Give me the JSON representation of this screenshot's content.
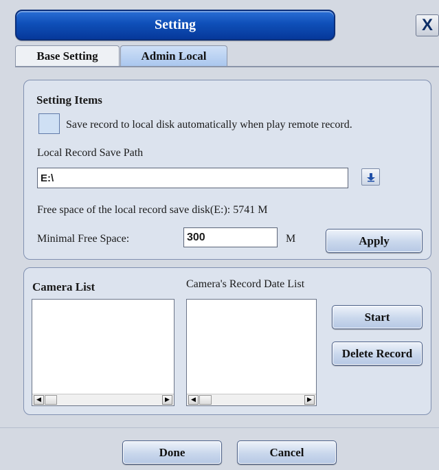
{
  "window": {
    "title": "Setting",
    "close_label": "X"
  },
  "tabs": [
    {
      "label": "Base Setting",
      "active": false
    },
    {
      "label": "Admin Local",
      "active": true
    }
  ],
  "setting_items": {
    "heading": "Setting Items",
    "auto_save_checkbox_label": "Save record to local disk automatically when play remote record.",
    "auto_save_checked": false,
    "save_path_label": "Local Record Save Path",
    "save_path_value": "E:\\",
    "free_space_text": "Free space of the local record save disk(E:): 5741 M",
    "min_free_label": "Minimal Free Space:",
    "min_free_value": "300",
    "min_free_unit": "M",
    "apply_label": "Apply"
  },
  "camera": {
    "camera_list_heading": "Camera List",
    "record_date_heading": "Camera's Record Date List",
    "camera_items": [],
    "date_items": [],
    "start_label": "Start",
    "delete_label": "Delete Record"
  },
  "footer": {
    "done_label": "Done",
    "cancel_label": "Cancel"
  },
  "colors": {
    "title_bar": "#0f4fb8",
    "panel_bg": "#dce3ee",
    "button_bg": "#c9d7ec"
  },
  "icons": {
    "browse": "down-arrow-icon",
    "close": "close-icon"
  }
}
